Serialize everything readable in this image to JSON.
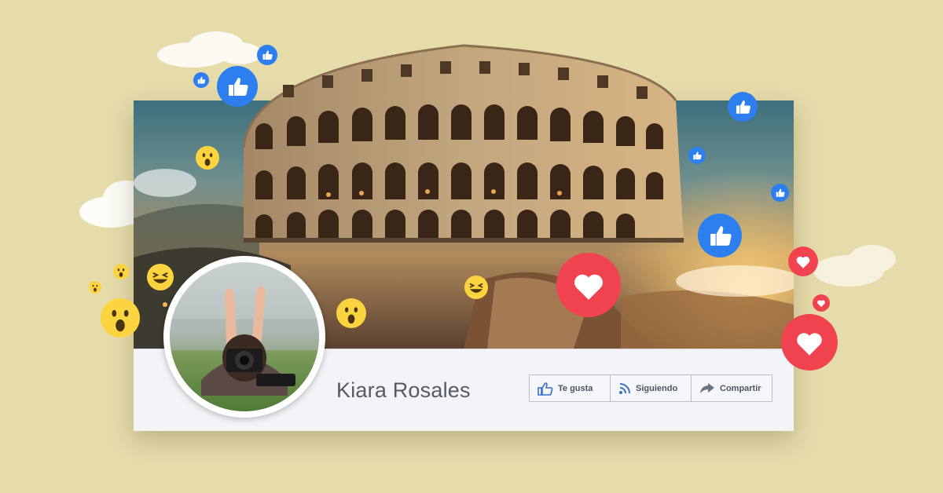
{
  "profile": {
    "name": "Kiara Rosales"
  },
  "actions": {
    "like_label": "Te gusta",
    "follow_label": "Siguiendo",
    "share_label": "Compartir"
  },
  "colors": {
    "background": "#e6dcaa",
    "like_blue": "#2d7ff0",
    "heart_red": "#f1434f",
    "emoji_yellow": "#fcd440"
  },
  "icons": [
    "like-icon",
    "rss-icon",
    "share-icon",
    "thumbs-up-icon",
    "heart-icon",
    "wow-emoji-icon",
    "laugh-emoji-icon",
    "cloud-icon"
  ]
}
